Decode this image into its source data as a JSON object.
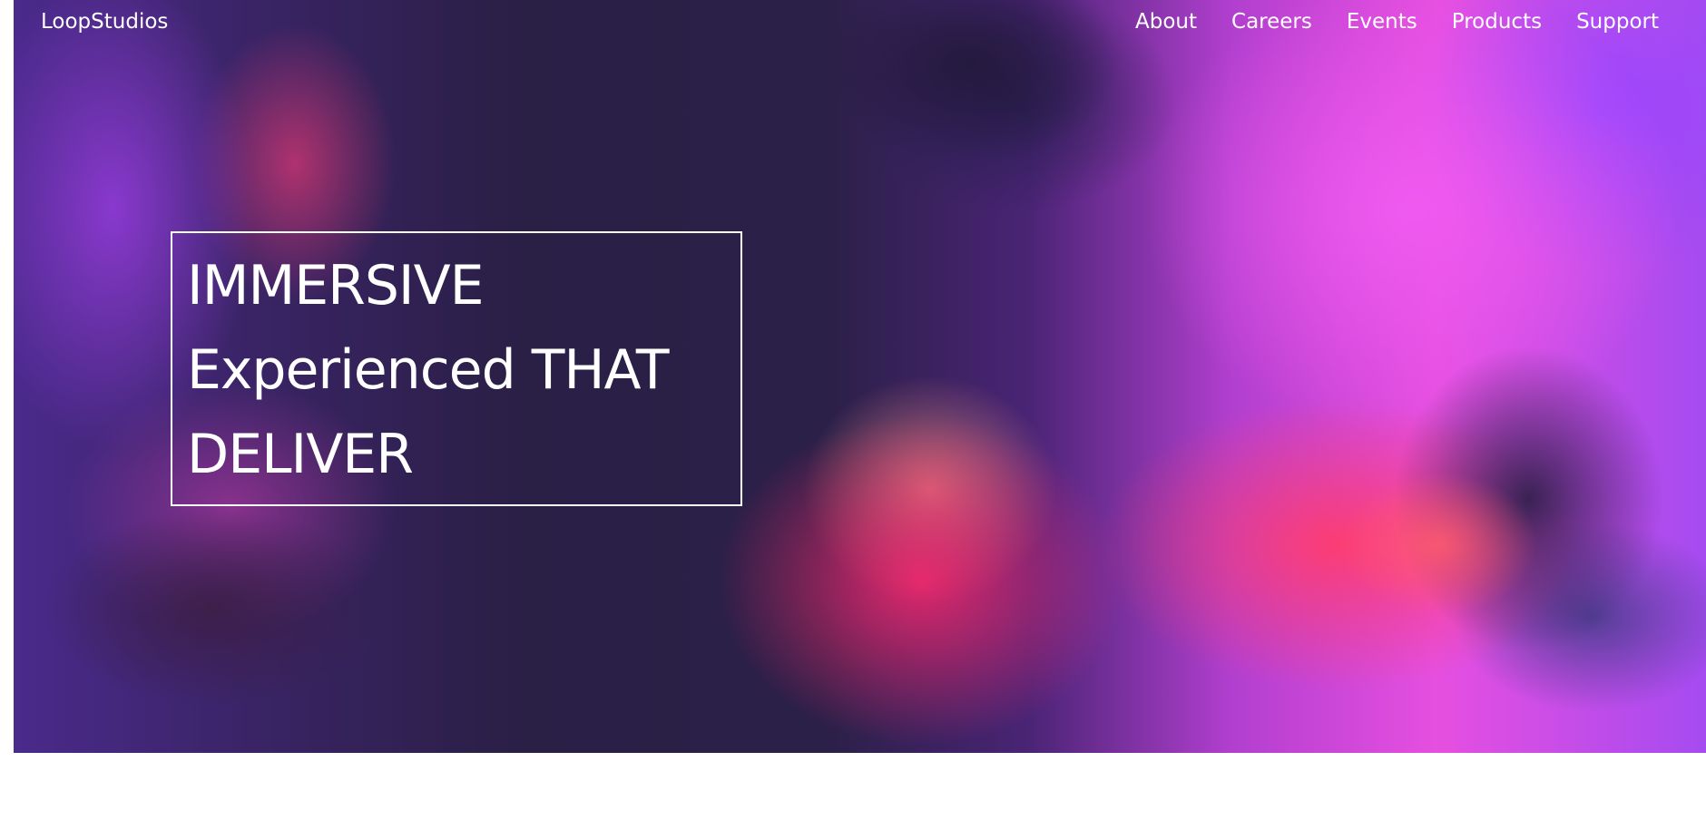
{
  "nav": {
    "logo": "LoopStudios",
    "links": [
      "About",
      "Careers",
      "Events",
      "Products",
      "Support"
    ]
  },
  "hero": {
    "headline_lines": [
      "IMMERSIVE",
      "Experienced THAT",
      "DELIVER"
    ],
    "image_description_icon": "vr-headset-racing-photo"
  },
  "colors": {
    "hero_magenta": "#e64fe0",
    "hero_dark": "#2a1f45",
    "hero_red": "#ff3c6e",
    "text": "#ffffff",
    "page_background": "#ffffff"
  }
}
